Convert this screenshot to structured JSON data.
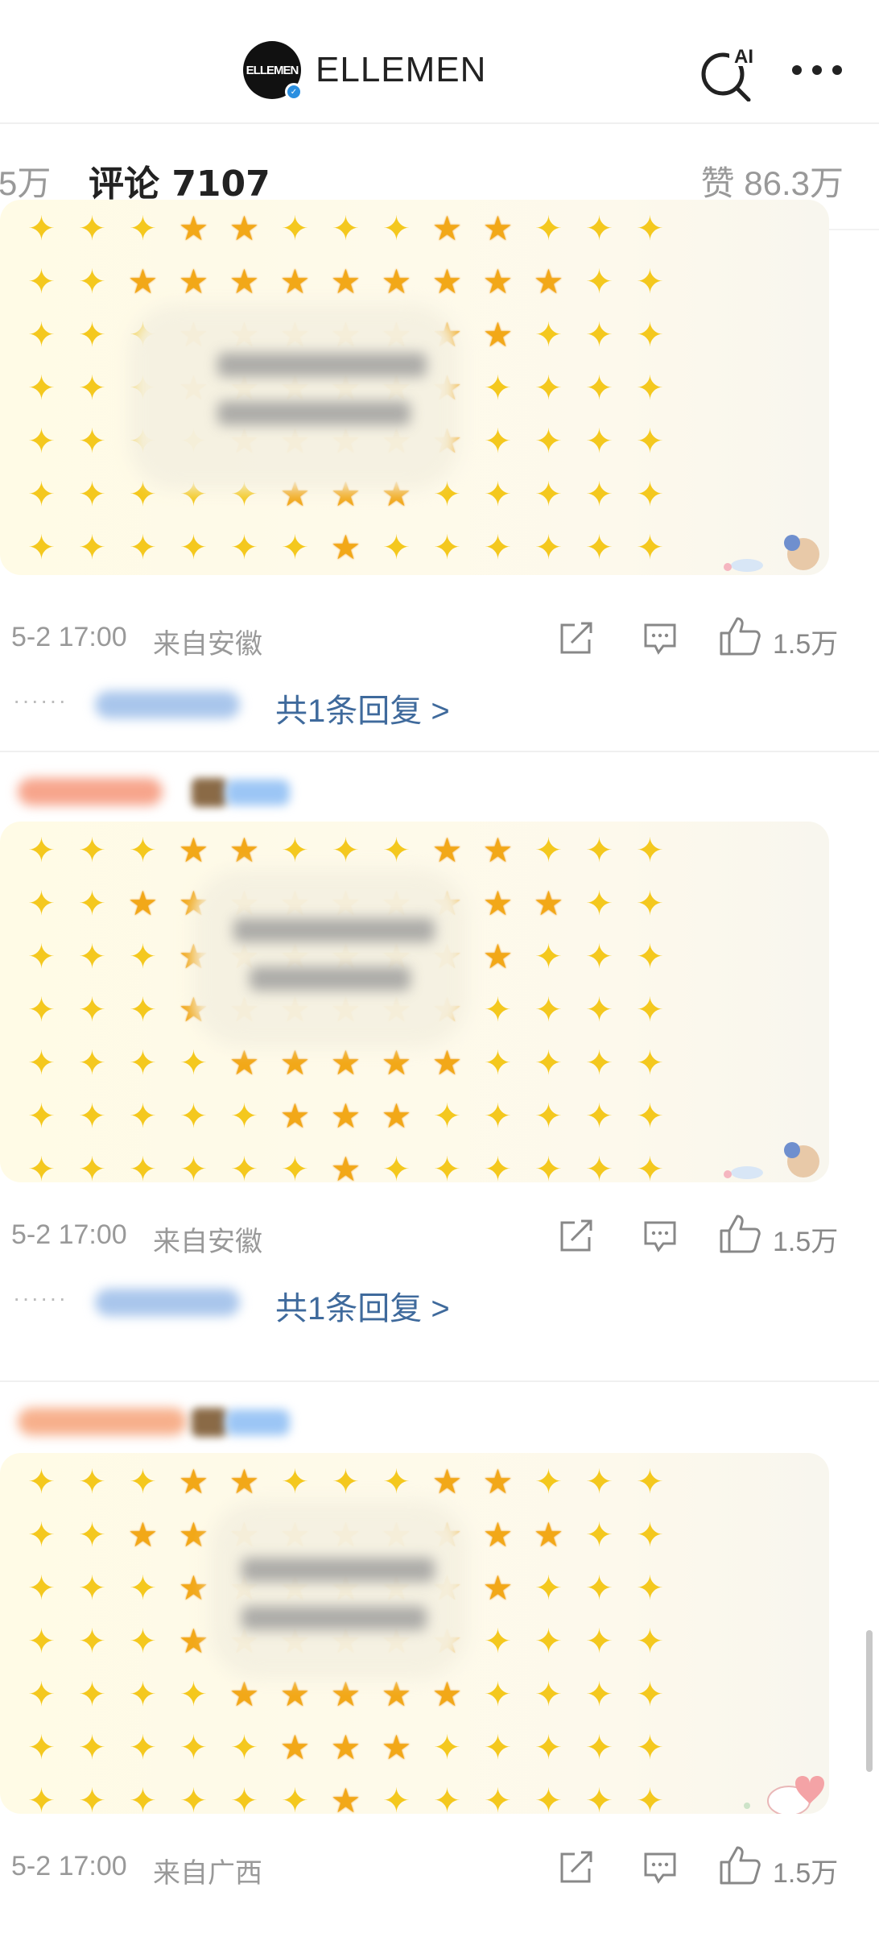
{
  "header": {
    "logo_text": "ELLEMEN",
    "account_name": "ELLEMEN",
    "ai_search_label": "AI"
  },
  "tabs": {
    "prev_tab_partial": "5万",
    "active_tab": "评论 7107",
    "likes": "赞 86.3万"
  },
  "comments": [
    {
      "date": "5-2 17:00",
      "location": "来自安徽",
      "like_count": "1.5万",
      "replies_label": "共1条回复 >",
      "reply_dots": "······",
      "name_color": "#f7a58c"
    },
    {
      "date": "5-2 17:00",
      "location": "来自安徽",
      "like_count": "1.5万",
      "replies_label": "共1条回复 >",
      "reply_dots": "······",
      "name_color": "#f7a58c"
    },
    {
      "date": "5-2 17:00",
      "location": "来自广西",
      "like_count": "1.5万",
      "name_color": "#f7a58c"
    }
  ],
  "emoji": {
    "sparkle": "✦",
    "star": "★"
  },
  "colors": {
    "accent": "#f36b21",
    "link": "#3f6a9c",
    "muted": "#999999"
  }
}
